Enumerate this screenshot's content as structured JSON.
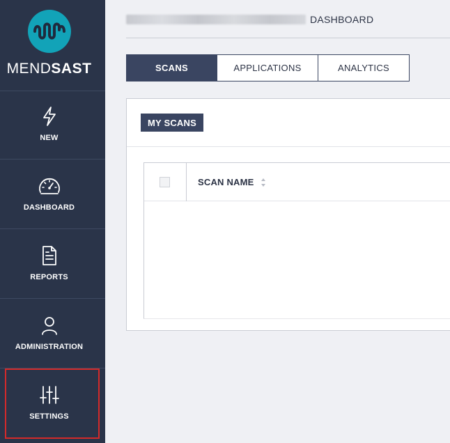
{
  "sidebar": {
    "logo": {
      "light": "MEND",
      "bold": "SAST"
    },
    "items": [
      {
        "label": "NEW",
        "icon": "lightning-icon"
      },
      {
        "label": "DASHBOARD",
        "icon": "gauge-icon"
      },
      {
        "label": "REPORTS",
        "icon": "document-icon"
      },
      {
        "label": "ADMINISTRATION",
        "icon": "user-icon"
      },
      {
        "label": "SETTINGS",
        "icon": "sliders-icon"
      }
    ]
  },
  "header": {
    "title": "DASHBOARD"
  },
  "tabs": [
    {
      "label": "SCANS",
      "active": true
    },
    {
      "label": "APPLICATIONS",
      "active": false
    },
    {
      "label": "ANALYTICS",
      "active": false
    }
  ],
  "card": {
    "title": "MY SCANS",
    "table": {
      "columns": [
        "SCAN NAME"
      ],
      "rows": []
    }
  },
  "colors": {
    "sidebar_bg": "#2a3449",
    "accent": "#3a4561",
    "logo_teal": "#12a3b8",
    "highlight": "#d42a2a"
  }
}
